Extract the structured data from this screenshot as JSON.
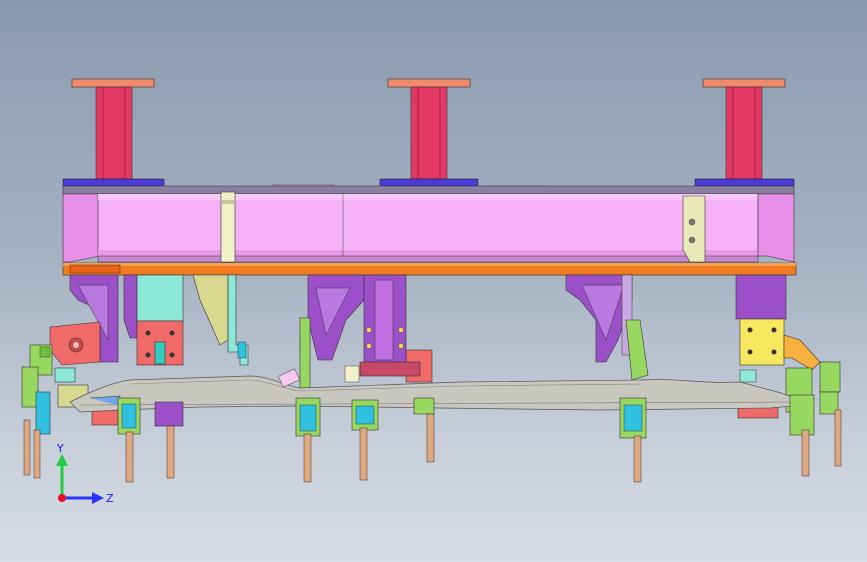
{
  "viewport": {
    "background_top": "#8a9aae",
    "background_bottom": "#d8dde4"
  },
  "triad": {
    "y_label": "Y",
    "z_label": "Z",
    "y_color": "#22cc44",
    "z_color": "#2a35ff",
    "origin_color": "#e01020"
  },
  "colors": {
    "post": "#e23a64",
    "post_cap": "#f08a6a",
    "beam": "#f6a8f4",
    "beam_top_plate": "#8a7fa0",
    "base_plate": "#f07a20",
    "bracket_purple": "#9b4fc8",
    "bracket_cyan": "#8ee8d8",
    "bracket_salmon": "#f06a6a",
    "bracket_yellow": "#f8e860",
    "bracket_olive": "#d8d890",
    "pin": "#e0a880",
    "part_gray": "#c8c8c0",
    "clamp_green": "#98d860"
  }
}
